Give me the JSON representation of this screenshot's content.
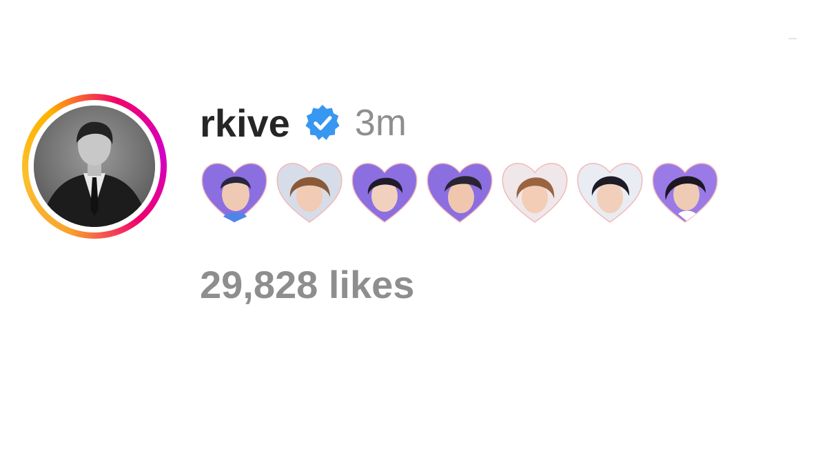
{
  "post_header": {
    "username": "rkive",
    "time_ago": "3m",
    "verified_icon": "verified-badge-icon",
    "verified_color": "#3897f0"
  },
  "caption": {
    "emojis": [
      {
        "icon": "heart-photo-icon",
        "bg": "#8b6ee0"
      },
      {
        "icon": "heart-photo-icon",
        "bg": "#d6dde8"
      },
      {
        "icon": "heart-photo-icon",
        "bg": "#8b6ee0"
      },
      {
        "icon": "heart-photo-icon",
        "bg": "#8b6ee0"
      },
      {
        "icon": "heart-photo-icon",
        "bg": "#efe7ea"
      },
      {
        "icon": "heart-photo-icon",
        "bg": "#e9ecf2"
      },
      {
        "icon": "heart-photo-icon",
        "bg": "#9a7ae6"
      }
    ]
  },
  "stats": {
    "likes_text": "29,828 likes"
  },
  "colors": {
    "username": "#262626",
    "secondary": "#8e8e8e",
    "story_ring_start": "#f9a12e",
    "story_ring_end": "#d300c5"
  }
}
